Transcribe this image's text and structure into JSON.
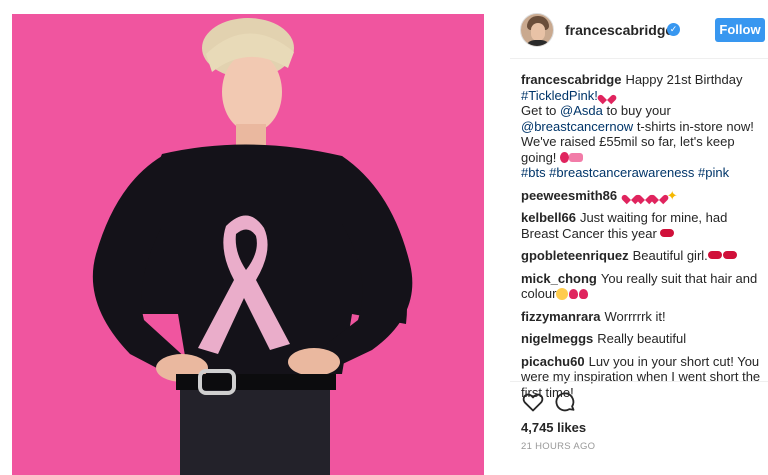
{
  "post": {
    "username": "francescabridge",
    "verified_icon": "verified-badge-icon",
    "follow_label": "Follow",
    "photo_description_icon": "post-photo"
  },
  "caption": {
    "user": "francescabridge",
    "line1": "Happy 21st Birthday",
    "hashtag1": "#TickledPink!",
    "text2_prefix": "Get to ",
    "mention1": "@Asda",
    "text2_suffix": " to buy your",
    "mention2": "@breastcancernow",
    "text3": " t-shirts in-store now! We've raised £55mil so far, let's keep going!",
    "hashtags2": "#bts #breastcancerawareness #pink"
  },
  "comments": [
    {
      "user": "peeweesmith86",
      "text": ""
    },
    {
      "user": "kelbell66",
      "text": "Just waiting for mine, had Breast Cancer this year"
    },
    {
      "user": "gpobleteenriquez",
      "text": "Beautiful girl."
    },
    {
      "user": "mick_chong",
      "text": "You really suit that hair and colour"
    },
    {
      "user": "fizzymanrara",
      "text": "Worrrrrk it!"
    },
    {
      "user": "nigelmeggs",
      "text": "Really beautiful"
    },
    {
      "user": "picachu60",
      "text": "Luv you in your short cut! You were my inspiration when I went short the first time!"
    }
  ],
  "actions": {
    "like_icon": "heart-icon",
    "comment_icon": "comment-icon",
    "likes_text": "4,745 likes",
    "timestamp": "21 HOURS AGO"
  },
  "colors": {
    "photo_background": "#f0559f",
    "follow_button": "#3897f0",
    "link": "#003569",
    "ribbon": "#f6b6d4"
  }
}
